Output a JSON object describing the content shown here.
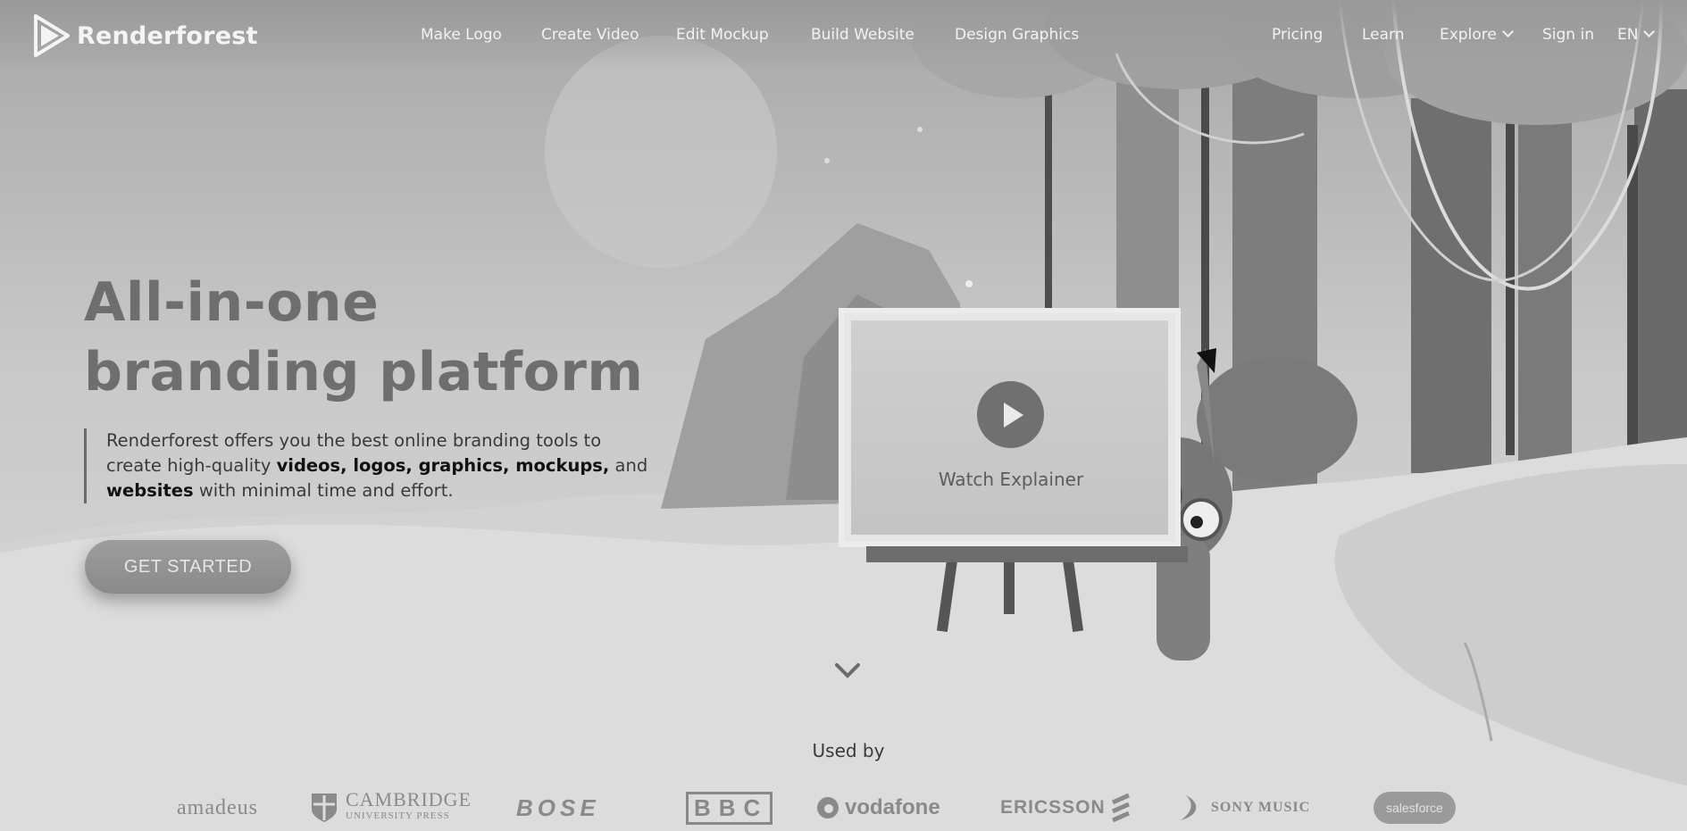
{
  "brand": {
    "name": "Renderforest"
  },
  "nav": {
    "items": [
      "Make Logo",
      "Create Video",
      "Edit Mockup",
      "Build Website",
      "Design Graphics"
    ],
    "pricing": "Pricing",
    "learn": "Learn",
    "explore": "Explore",
    "signin": "Sign in",
    "lang": "EN"
  },
  "hero": {
    "headline_line1": "All-in-one",
    "headline_line2": "branding platform",
    "desc_part1": "Renderforest offers you the best online branding tools to create high-quality ",
    "desc_bold1": "videos, logos, graphics, mockups,",
    "desc_part2": " and ",
    "desc_bold2": "websites",
    "desc_part3": " with minimal time and effort.",
    "cta": "GET STARTED"
  },
  "video": {
    "label": "Watch Explainer"
  },
  "used_by": {
    "label": "Used by",
    "clients": [
      "amadeus",
      "CAMBRIDGE",
      "UNIVERSITY PRESS",
      "BOSE",
      "BBC",
      "vodafone",
      "ERICSSON",
      "SONY MUSIC",
      "salesforce"
    ]
  },
  "colors": {
    "accent": "#707070",
    "background": "#d8d8d8",
    "nav_text": "#f2f2f2"
  }
}
